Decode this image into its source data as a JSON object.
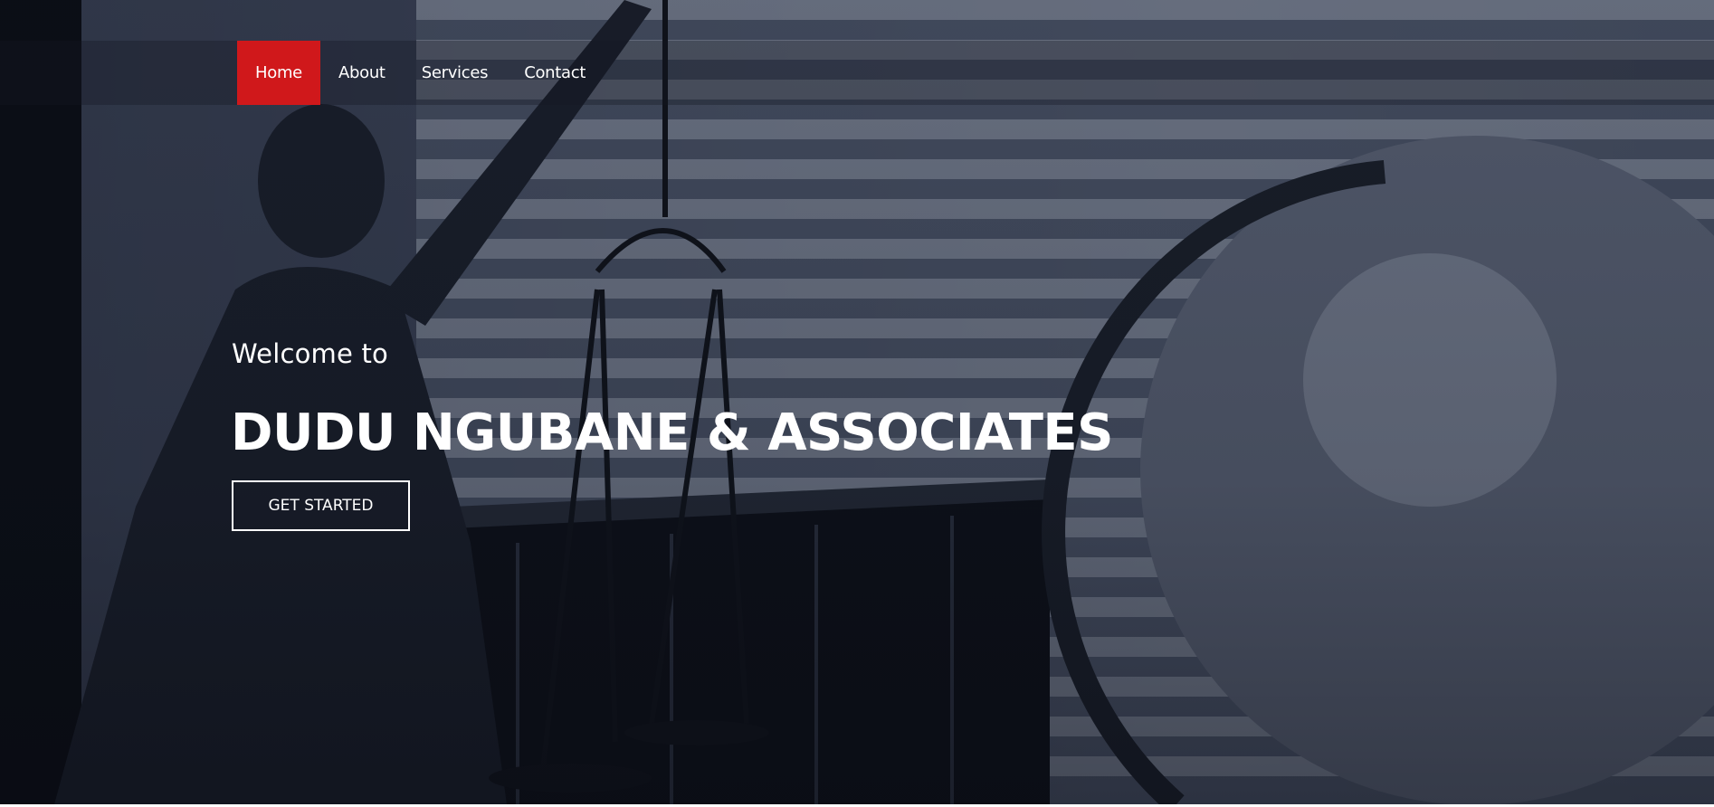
{
  "nav": {
    "items": [
      {
        "label": "Home",
        "active": true
      },
      {
        "label": "About",
        "active": false
      },
      {
        "label": "Services",
        "active": false
      },
      {
        "label": "Contact",
        "active": false
      }
    ]
  },
  "hero": {
    "welcome": "Welcome to",
    "title": "DUDU NGUBANE & ASSOCIATES",
    "cta_label": "GET STARTED"
  },
  "colors": {
    "accent": "#d0181b",
    "text": "#ffffff",
    "hero_tint": "#3a4255"
  }
}
